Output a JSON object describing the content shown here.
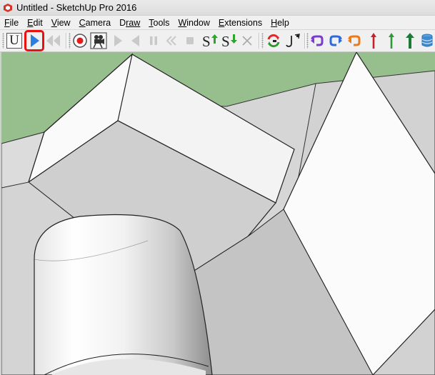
{
  "window": {
    "title": "Untitled - SketchUp Pro 2016"
  },
  "menu": [
    {
      "label": "File",
      "accel": "F",
      "rest": "ile"
    },
    {
      "label": "Edit",
      "accel": "E",
      "rest": "dit"
    },
    {
      "label": "View",
      "accel": "V",
      "rest": "iew"
    },
    {
      "label": "Camera",
      "accel": "C",
      "rest": "amera"
    },
    {
      "label": "Draw",
      "accel": "D",
      "rest": "raw"
    },
    {
      "label": "Tools",
      "accel": "T",
      "rest": "ools"
    },
    {
      "label": "Window",
      "accel": "W",
      "rest": "indow"
    },
    {
      "label": "Extensions",
      "accel": "E",
      "rest": "xtensions"
    },
    {
      "label": "Help",
      "accel": "H",
      "rest": "elp"
    }
  ],
  "toolbar": {
    "u_label": "U",
    "scene_up_label": "S",
    "scene_down_label": "S",
    "highlighted_tool": "play-button",
    "accent_color": "#e8120f",
    "play_color": "#2a7de1"
  },
  "scene": {
    "sky_color": "#97be8d",
    "ground_color": "#d8d8d8"
  }
}
